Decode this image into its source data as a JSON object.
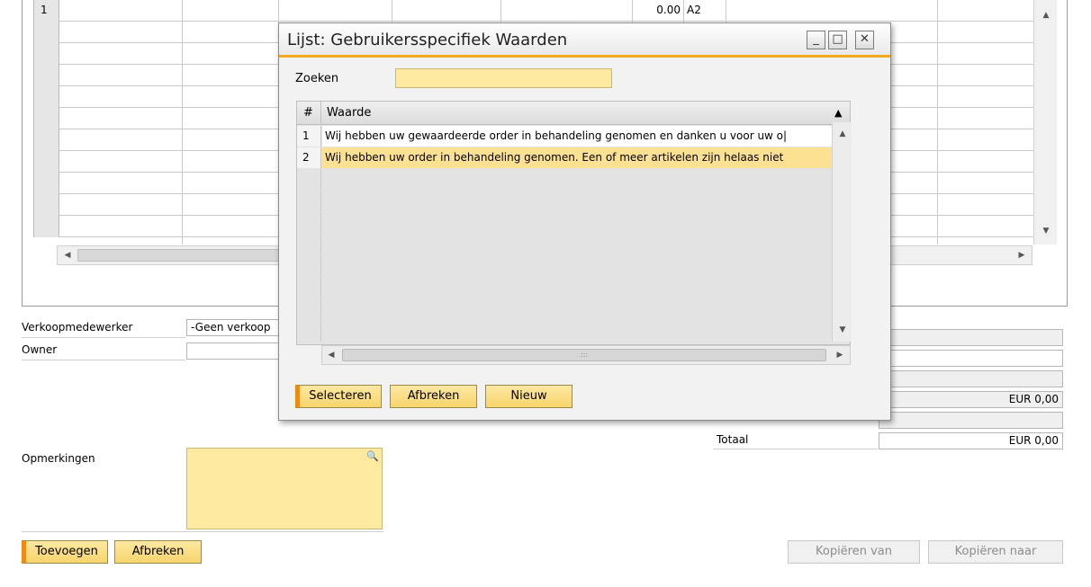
{
  "background": {
    "grid": {
      "first_row_number": "1",
      "first_row_amount": "0.00",
      "first_row_code": "A2"
    },
    "sales_employee": {
      "label": "Verkoopmedewerker",
      "value": "-Geen verkoop"
    },
    "owner": {
      "label": "Owner",
      "value": ""
    },
    "remarks": {
      "label": "Opmerkingen",
      "value": ""
    },
    "totals": {
      "amount_1": "EUR 0,00",
      "total_label": "Totaal",
      "total_value": "EUR 0,00"
    },
    "buttons": {
      "add": "Toevoegen",
      "cancel": "Afbreken",
      "copy_from": "Kopiëren van",
      "copy_to": "Kopiëren naar"
    }
  },
  "dialog": {
    "title": "Lijst: Gebruikersspecifiek Waarden",
    "window_buttons": {
      "minimize": "_",
      "maximize": "□",
      "close": "✕"
    },
    "search": {
      "label": "Zoeken",
      "value": ""
    },
    "grid": {
      "columns": [
        "#",
        "Waarde"
      ],
      "rows": [
        {
          "num": "1",
          "value": "Wij hebben uw gewaardeerde order in behandeling genomen en danken u voor uw o|"
        },
        {
          "num": "2",
          "value": "Wij hebben uw order in behandeling genomen. Een of meer artikelen zijn helaas niet"
        }
      ],
      "selected_row": 2
    },
    "buttons": {
      "select": "Selecteren",
      "cancel": "Afbreken",
      "new": "Nieuw"
    }
  },
  "colors": {
    "accent_orange": "#ef8a12",
    "title_underline": "#f3a91d",
    "field_yellow": "#fde9a0",
    "selected_row": "#fde193"
  }
}
